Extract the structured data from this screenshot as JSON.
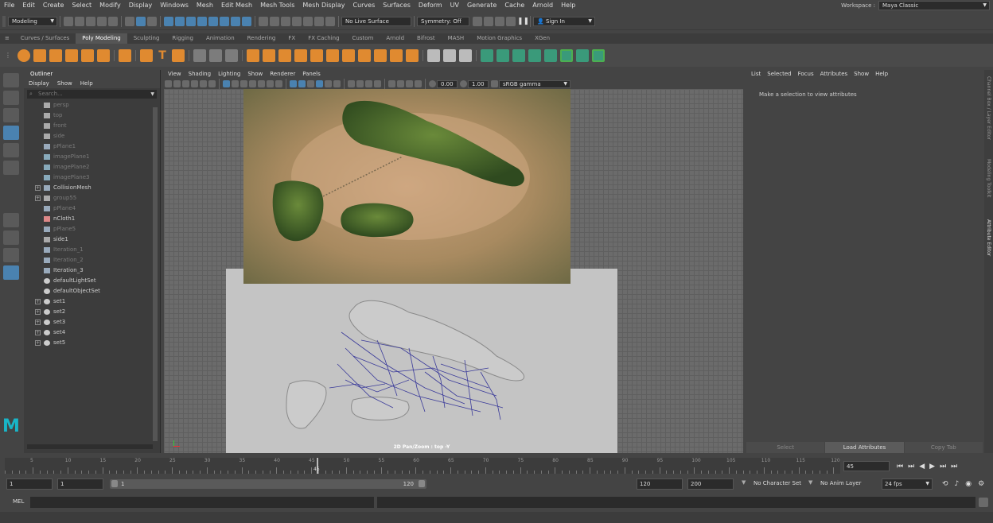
{
  "menubar": {
    "items": [
      "File",
      "Edit",
      "Create",
      "Select",
      "Modify",
      "Display",
      "Windows",
      "Mesh",
      "Edit Mesh",
      "Mesh Tools",
      "Mesh Display",
      "Curves",
      "Surfaces",
      "Deform",
      "UV",
      "Generate",
      "Cache",
      "Arnold",
      "Help"
    ],
    "workspace_label": "Workspace :",
    "workspace_value": "Maya Classic"
  },
  "statusline": {
    "mode": "Modeling",
    "live_surface": "No Live Surface",
    "symmetry": "Symmetry: Off",
    "sign_in": "Sign In"
  },
  "shelf": {
    "tabs": [
      "Curves / Surfaces",
      "Poly Modeling",
      "Sculpting",
      "Rigging",
      "Animation",
      "Rendering",
      "FX",
      "FX Caching",
      "Custom",
      "Arnold",
      "Bifrost",
      "MASH",
      "Motion Graphics",
      "XGen"
    ],
    "active": "Poly Modeling"
  },
  "outliner": {
    "title": "Outliner",
    "menu": [
      "Display",
      "Show",
      "Help"
    ],
    "search_placeholder": "Search...",
    "items": [
      {
        "label": "persp",
        "dim": true,
        "exp": false,
        "icon": "camera"
      },
      {
        "label": "top",
        "dim": true,
        "exp": false,
        "icon": "camera"
      },
      {
        "label": "front",
        "dim": true,
        "exp": false,
        "icon": "camera"
      },
      {
        "label": "side",
        "dim": true,
        "exp": false,
        "icon": "camera"
      },
      {
        "label": "pPlane1",
        "dim": true,
        "exp": false,
        "icon": "mesh"
      },
      {
        "label": "imagePlane1",
        "dim": true,
        "exp": false,
        "icon": "imageplane"
      },
      {
        "label": "imagePlane2",
        "dim": true,
        "exp": false,
        "icon": "imageplane"
      },
      {
        "label": "imagePlane3",
        "dim": true,
        "exp": false,
        "icon": "imageplane"
      },
      {
        "label": "CollisionMesh",
        "dim": false,
        "exp": true,
        "icon": "mesh"
      },
      {
        "label": "group55",
        "dim": true,
        "exp": true,
        "icon": "group"
      },
      {
        "label": "pPlane4",
        "dim": true,
        "exp": false,
        "icon": "mesh"
      },
      {
        "label": "nCloth1",
        "dim": false,
        "exp": false,
        "icon": "ncloth"
      },
      {
        "label": "pPlane5",
        "dim": true,
        "exp": false,
        "icon": "mesh"
      },
      {
        "label": "side1",
        "dim": false,
        "exp": false,
        "icon": "camera"
      },
      {
        "label": "Iteration_1",
        "dim": true,
        "exp": false,
        "icon": "mesh"
      },
      {
        "label": "Iteration_2",
        "dim": true,
        "exp": false,
        "icon": "mesh"
      },
      {
        "label": "Iteration_3",
        "dim": false,
        "exp": false,
        "icon": "mesh"
      },
      {
        "label": "defaultLightSet",
        "dim": false,
        "exp": false,
        "icon": "set"
      },
      {
        "label": "defaultObjectSet",
        "dim": false,
        "exp": false,
        "icon": "set"
      },
      {
        "label": "set1",
        "dim": false,
        "exp": true,
        "icon": "set"
      },
      {
        "label": "set2",
        "dim": false,
        "exp": true,
        "icon": "set"
      },
      {
        "label": "set3",
        "dim": false,
        "exp": true,
        "icon": "set"
      },
      {
        "label": "set4",
        "dim": false,
        "exp": true,
        "icon": "set"
      },
      {
        "label": "set5",
        "dim": false,
        "exp": true,
        "icon": "set"
      }
    ]
  },
  "viewport": {
    "menu": [
      "View",
      "Shading",
      "Lighting",
      "Show",
      "Renderer",
      "Panels"
    ],
    "exposure": "0.00",
    "gamma": "1.00",
    "color_space": "sRGB gamma",
    "camera_label": "2D Pan/Zoom : top -Y"
  },
  "attribute_editor": {
    "menu": [
      "List",
      "Selected",
      "Focus",
      "Attributes",
      "Show",
      "Help"
    ],
    "message": "Make a selection to view attributes",
    "buttons": [
      "Select",
      "Load Attributes",
      "Copy Tab"
    ],
    "side_tabs": [
      "Channel Box / Layer Editor",
      "Modeling Toolkit",
      "Attribute Editor"
    ]
  },
  "timeline": {
    "ticks": [
      "5",
      "10",
      "15",
      "20",
      "25",
      "30",
      "35",
      "40",
      "45",
      "50",
      "55",
      "60",
      "65",
      "70",
      "75",
      "80",
      "85",
      "90",
      "95",
      "100",
      "105",
      "110",
      "115",
      "120"
    ],
    "current_frame": "45",
    "current_field": "45"
  },
  "range": {
    "start": "1",
    "start_inner": "1",
    "slider_start": "1",
    "slider_end": "120",
    "end_inner": "120",
    "end": "200",
    "character_set": "No Character Set",
    "anim_layer": "No Anim Layer",
    "fps": "24 fps"
  },
  "command": {
    "label": "MEL"
  }
}
